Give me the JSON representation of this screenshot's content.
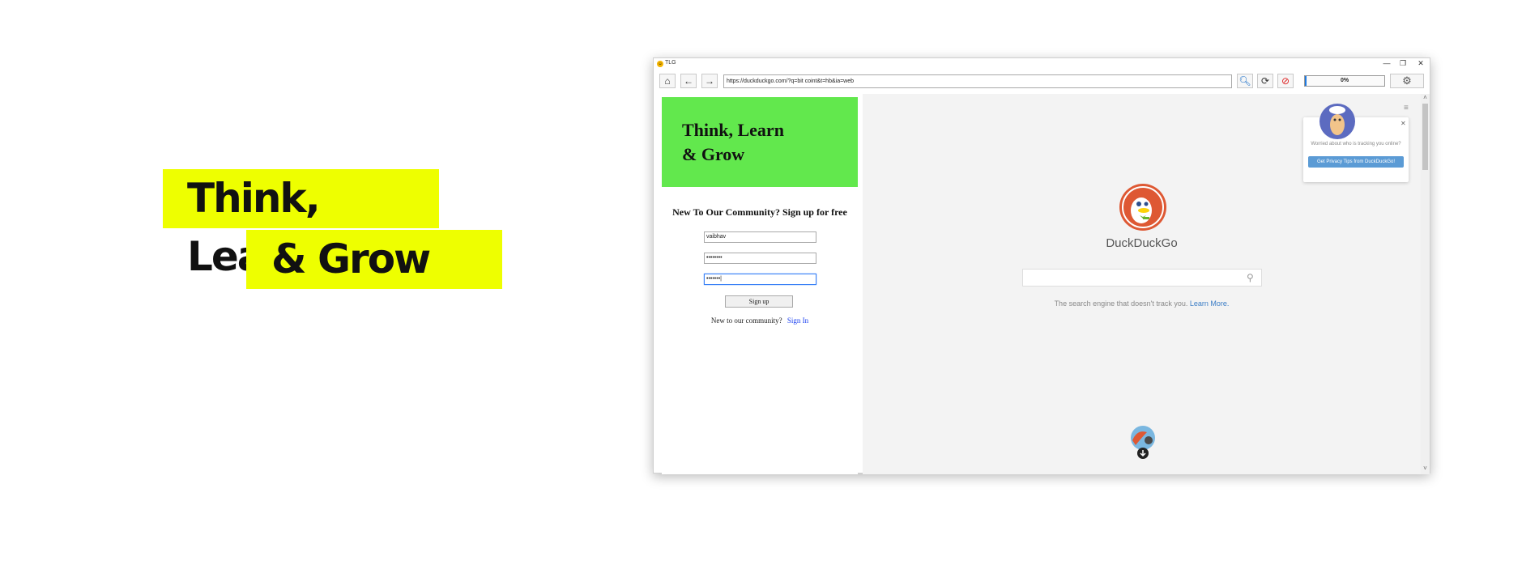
{
  "promo": {
    "line1": "Think, Learn",
    "line2": "& Grow",
    "color": "#eeff00"
  },
  "window": {
    "title": "TLG",
    "controls": {
      "minimize": "—",
      "maximize": "❐",
      "close": "✕"
    }
  },
  "toolbar": {
    "url": "https://duckduckgo.com/?q=bit coint&t=hb&ia=web",
    "progress_value": 0,
    "progress_label": "0%"
  },
  "left_panel": {
    "hero": {
      "line1": "Think, Learn",
      "line2": "& Grow",
      "color": "#62e84d"
    },
    "signup_title": "New To Our Community? Sign up for free",
    "fields": [
      {
        "value": "vaibhav"
      },
      {
        "value": "••••••••"
      },
      {
        "value": "•••••••|"
      }
    ],
    "signup_button": "Sign up",
    "signin_prompt": "New to our community?",
    "signin_link": "Sign In"
  },
  "ddg": {
    "name": "DuckDuckGo",
    "tagline": "The search engine that doesn't track you.",
    "learn_more": "Learn More.",
    "privacy_text": "Worried about who is tracking you online?",
    "privacy_button": "Get Privacy Tips from DuckDuckGo!",
    "accent": "#de5833"
  }
}
